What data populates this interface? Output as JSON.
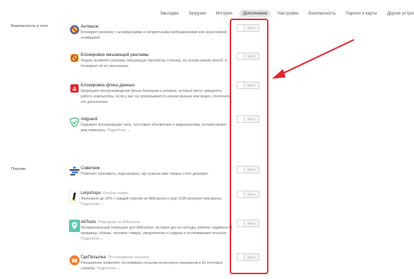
{
  "nav": {
    "items": [
      {
        "label": "Закладки",
        "active": false
      },
      {
        "label": "Загрузки",
        "active": false
      },
      {
        "label": "История",
        "active": false
      },
      {
        "label": "Дополнения",
        "active": true
      },
      {
        "label": "Настройки",
        "active": false
      },
      {
        "label": "Безопасность",
        "active": false
      },
      {
        "label": "Пароли и карты",
        "active": false
      },
      {
        "label": "Другие устройства",
        "active": false
      }
    ]
  },
  "sections": {
    "security": "Безопасность в сети",
    "shopping": "Покупки"
  },
  "toggle_label": "Выкл.",
  "more_label": "Подробнее",
  "extensions": [
    {
      "name": "Антишок",
      "sub": "",
      "desc": "Блокирует рекламу с шокирующими и неприятными изображениями или агрессивной анимацией.",
      "more": false
    },
    {
      "name": "Блокировка мешающей рекламы",
      "sub": "",
      "desc": "Яндекс выявляет рекламу, мешающую просмотру страниц, на основе ваших жалоб, и блокирует её по умолчанию.",
      "more": false
    },
    {
      "name": "Блокировка флеш-данных",
      "sub": "",
      "desc": "Запрещает воспроизведение флеш-баннеров и роликов, которые могут замедлить работу компьютера. Если у вас не проигрывается нужная музыка или видео, отключите это дополнение.",
      "more": false
    },
    {
      "name": "Adguard",
      "sub": "",
      "desc": "Скрывает всплывающие окна, текстовые объявления и видеорекламу, которая может вам помешать.",
      "more": true
    },
    {
      "name": "Советник",
      "sub": "",
      "desc": "Помогает экономить, подсказывая, где нужные вам товары стоят дешевле.",
      "more": false
    },
    {
      "name": "Letyshops",
      "sub": "Кэшбэк-сервис",
      "desc": "Экономьте до 30% с каждой покупки на AliExpress и ещё 1026 интернет-магазинах.",
      "more": true
    },
    {
      "name": "AliTools",
      "sub": "Помощник на AliExpress",
      "desc": "Функциональный помощник для AliExpress: история цен за полгода, рейтинг надёжности продавца, обзоры, похожие товары, уведомления о скидках и отслеживание посылок.",
      "more": true
    },
    {
      "name": "ГдеПосылка",
      "sub": "Отслеживание посылок",
      "desc": "Расширение позволяет отслеживать посылки из интернет-магазинов в 92 почтовых службах.",
      "more": true
    }
  ],
  "colors": {
    "highlight": "#e0262c",
    "arrow": "#e0262c"
  }
}
